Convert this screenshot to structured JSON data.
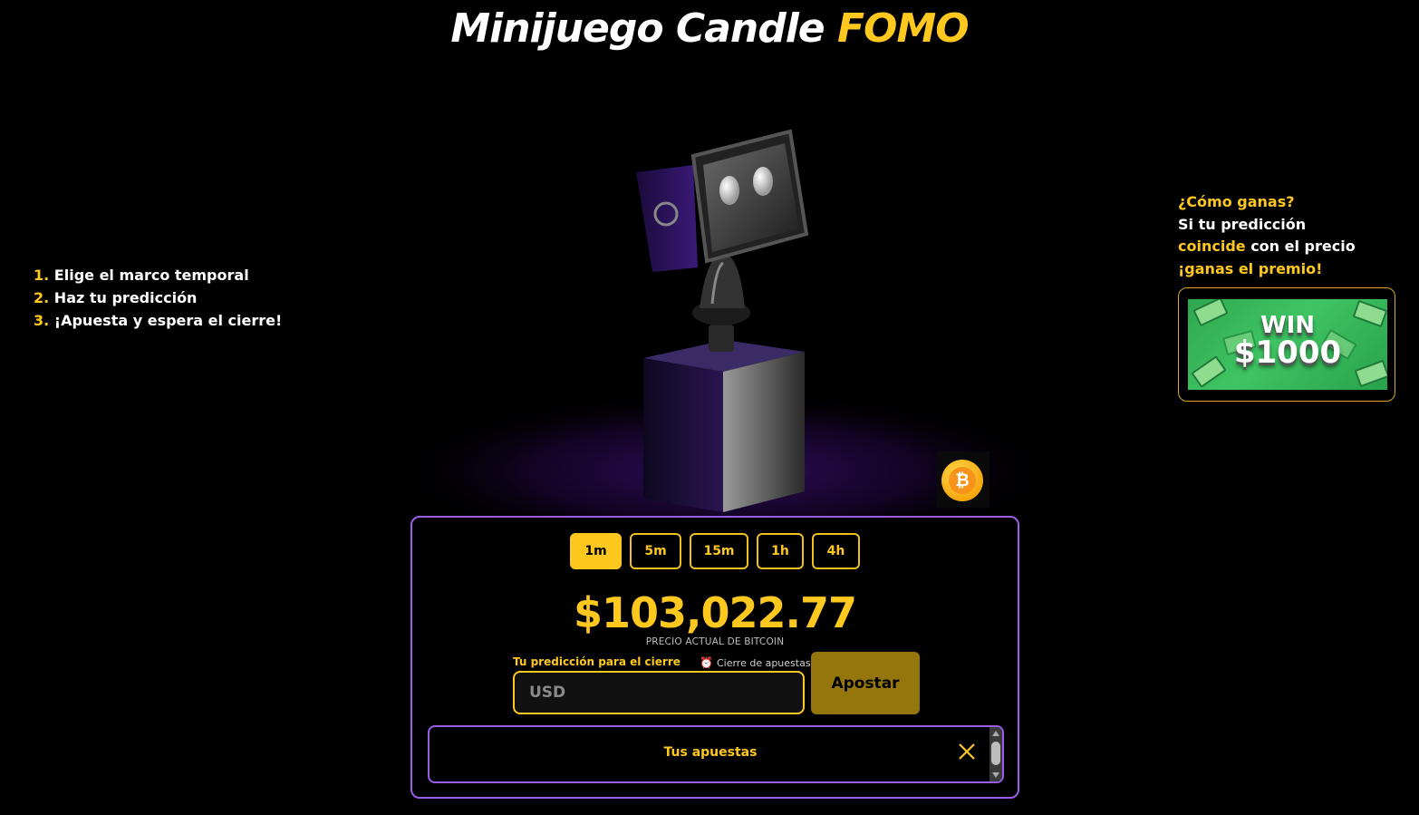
{
  "header": {
    "title_main": "Minijuego Candle",
    "title_accent": "FOMO"
  },
  "steps": [
    {
      "num": "1.",
      "text": "Elige el marco temporal"
    },
    {
      "num": "2.",
      "text": "Haz tu predicción"
    },
    {
      "num": "3.",
      "text": "¡Apuesta y espera el cierre!"
    }
  ],
  "how_to_win": {
    "question": "¿Cómo ganas?",
    "line1": "Si tu predicción",
    "highlight": "coincide",
    "line2_rest": " con el precio",
    "prize_text": "¡ganas el premio!"
  },
  "prize_banner": {
    "win": "WIN",
    "amount": "$1000"
  },
  "timeframes": [
    {
      "label": "1m",
      "active": true
    },
    {
      "label": "5m",
      "active": false
    },
    {
      "label": "15m",
      "active": false
    },
    {
      "label": "1h",
      "active": false
    },
    {
      "label": "4h",
      "active": false
    }
  ],
  "price": {
    "value": "$103,022.77",
    "label": "PRECIO ACTUAL DE BITCOIN"
  },
  "prediction": {
    "label": "Tu predicción para el cierre",
    "close_label": "Cierre de apuestas",
    "placeholder": "USD",
    "value": ""
  },
  "bet_button": {
    "label": "Apostar"
  },
  "bets_panel": {
    "title": "Tus apuestas"
  },
  "colors": {
    "accent_yellow": "#ffc81e",
    "purple_border": "#9b5de5",
    "bet_button": "#94760c"
  },
  "icons": {
    "coin": "bitcoin-icon",
    "alarm": "alarm-clock-icon",
    "close": "close-icon"
  }
}
